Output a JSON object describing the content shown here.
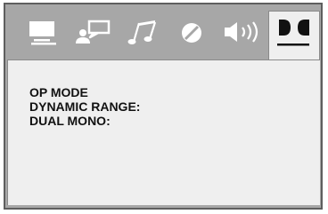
{
  "tabs": [
    {
      "icon": "monitor-icon",
      "active": false
    },
    {
      "icon": "user-speech-icon",
      "active": false
    },
    {
      "icon": "music-note-icon",
      "active": false
    },
    {
      "icon": "restriction-icon",
      "active": false
    },
    {
      "icon": "speaker-icon",
      "active": false
    },
    {
      "icon": "dolby-icon",
      "active": true
    }
  ],
  "menu": {
    "items": [
      {
        "label": "OP MODE"
      },
      {
        "label": "DYNAMIC RANGE:"
      },
      {
        "label": "DUAL MONO:"
      }
    ]
  },
  "colors": {
    "panel_background": "#a7a7a7",
    "content_background": "#efefef",
    "icon_color": "#ffffff",
    "active_icon_color": "#111111",
    "text_color": "#111111"
  }
}
